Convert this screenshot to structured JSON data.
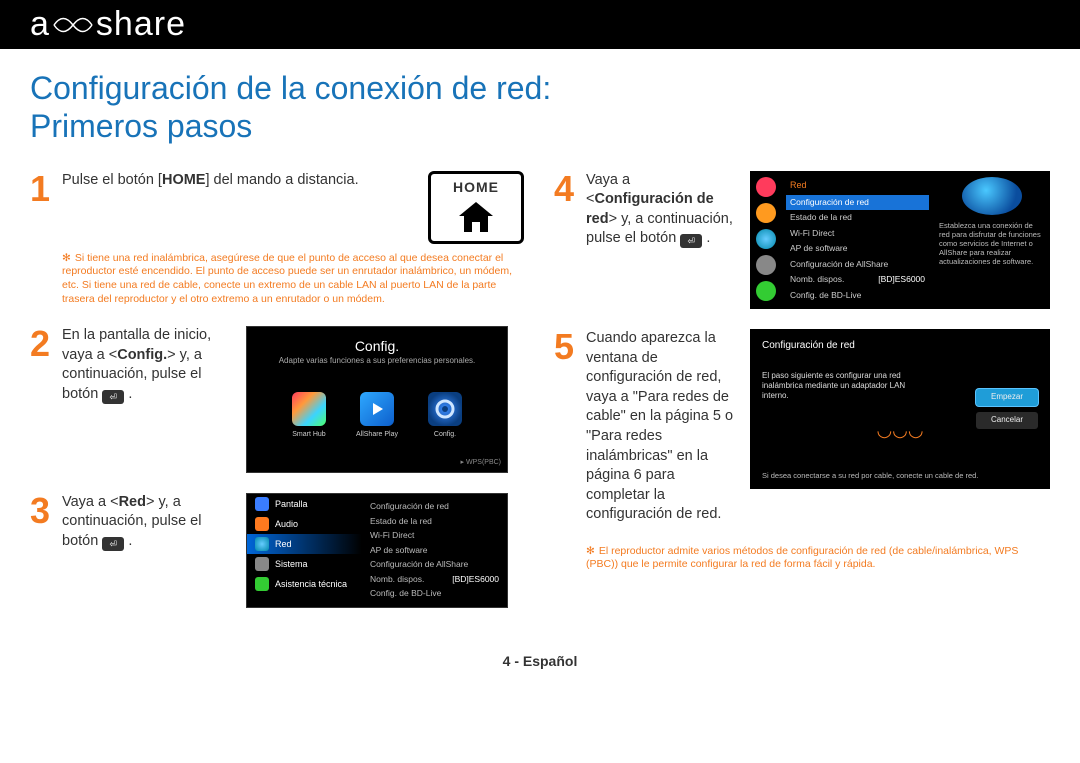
{
  "brand": "allshare",
  "title": "Configuración de la conexión de red:\nPrimeros pasos",
  "footer": "4 - Español",
  "home_label": "HOME",
  "steps": {
    "s1": {
      "text_a": "Pulse el botón [",
      "text_b": "HOME",
      "text_c": "] del mando a distancia.",
      "note": "Si tiene una red inalámbrica, asegúrese de que el punto de acceso al que desea conectar el reproductor esté encendido. El punto de acceso puede ser un enrutador inalámbrico, un módem, etc. Si tiene una red de cable, conecte un extremo de un cable LAN al puerto LAN de la parte trasera del reproductor y el otro extremo a un enrutador o un módem."
    },
    "s2": {
      "text_a": "En la pantalla de inicio, vaya a <",
      "text_b": "Config.",
      "text_c": "> y, a continuación, pulse el botón "
    },
    "s3": {
      "text_a": "Vaya a <",
      "text_b": "Red",
      "text_c": "> y, a continuación, pulse el botón "
    },
    "s4": {
      "text_a": "Vaya a <",
      "text_b": "Configuración de red",
      "text_c": "> y, a continuación, pulse el botón "
    },
    "s5": {
      "text": "Cuando aparezca la ventana de configuración de red, vaya a \"Para redes de cable\" en la página 5 o \"Para redes inalámbricas\" en la página 6 para completar la configuración de red.",
      "note": "El reproductor admite varios métodos de configuración de red (de cable/inalámbrica, WPS (PBC)) que le permite configurar la red de forma fácil y rápida."
    }
  },
  "config_shot": {
    "title": "Config.",
    "sub": "Adapte varias funciones a sus preferencias personales.",
    "apps": [
      "Smart Hub",
      "AllShare Play",
      "Config."
    ],
    "corner": "WPS(PBC)"
  },
  "red_shot": {
    "side": [
      "Pantalla",
      "Audio",
      "Red",
      "Sistema",
      "Asistencia técnica"
    ],
    "panel": [
      "Configuración de red",
      "Estado de la red",
      "Wi-Fi Direct",
      "AP de software",
      "Configuración de AllShare",
      "Nomb. dispos.",
      "Config. de BD-Live"
    ],
    "dev": "[BD]ES6000"
  },
  "net_shot": {
    "head": "Red",
    "items": [
      "Configuración de red",
      "Estado de la red",
      "Wi-Fi Direct",
      "AP de software",
      "Configuración de AllShare",
      "Nomb. dispos.",
      "Config. de BD-Live"
    ],
    "dev": "[BD]ES6000",
    "desc": "Establezca una conexión de red para disfrutar de funciones como servicios de Internet o AllShare para realizar actualizaciones de software."
  },
  "wiz_shot": {
    "title": "Configuración de red",
    "msg": "El paso siguiente es configurar una red inalámbrica mediante un adaptador LAN interno.",
    "btn_start": "Empezar",
    "btn_cancel": "Cancelar",
    "hint": "Si desea conectarse a su red por cable, conecte un cable de red."
  }
}
